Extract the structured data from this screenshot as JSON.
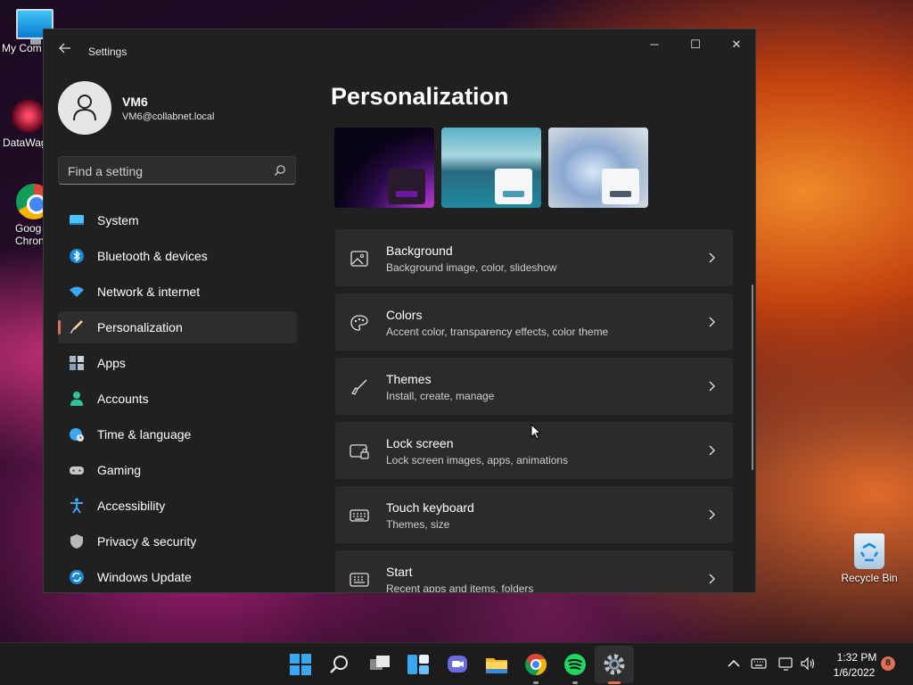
{
  "desktop": {
    "icons": [
      {
        "label": "My Com"
      },
      {
        "label": "DataWag"
      },
      {
        "label": "Goog Chron"
      },
      {
        "label": "Recycle Bin"
      }
    ]
  },
  "window": {
    "title": "Settings",
    "controls": {
      "minimize": "─",
      "maximize": "☐",
      "close": "✕"
    }
  },
  "profile": {
    "name": "VM6",
    "email": "VM6@collabnet.local"
  },
  "search": {
    "placeholder": "Find a setting"
  },
  "nav": {
    "items": [
      {
        "label": "System",
        "icon": "monitor-icon"
      },
      {
        "label": "Bluetooth & devices",
        "icon": "bluetooth-icon"
      },
      {
        "label": "Network & internet",
        "icon": "wifi-icon"
      },
      {
        "label": "Personalization",
        "icon": "brush-icon",
        "active": true
      },
      {
        "label": "Apps",
        "icon": "apps-icon"
      },
      {
        "label": "Accounts",
        "icon": "person-icon"
      },
      {
        "label": "Time & language",
        "icon": "globe-clock-icon"
      },
      {
        "label": "Gaming",
        "icon": "gamepad-icon"
      },
      {
        "label": "Accessibility",
        "icon": "accessibility-icon"
      },
      {
        "label": "Privacy & security",
        "icon": "shield-icon"
      },
      {
        "label": "Windows Update",
        "icon": "update-icon"
      }
    ]
  },
  "main": {
    "title": "Personalization",
    "cards": [
      {
        "title": "Background",
        "subtitle": "Background image, color, slideshow",
        "icon": "image-icon"
      },
      {
        "title": "Colors",
        "subtitle": "Accent color, transparency effects, color theme",
        "icon": "palette-icon"
      },
      {
        "title": "Themes",
        "subtitle": "Install, create, manage",
        "icon": "brush-icon"
      },
      {
        "title": "Lock screen",
        "subtitle": "Lock screen images, apps, animations",
        "icon": "lock-screen-icon"
      },
      {
        "title": "Touch keyboard",
        "subtitle": "Themes, size",
        "icon": "keyboard-icon"
      },
      {
        "title": "Start",
        "subtitle": "Recent apps and items, folders",
        "icon": "start-icon"
      }
    ]
  },
  "taskbar": {
    "time": "1:32 PM",
    "date": "1/6/2022",
    "notification_count": "8"
  },
  "colors": {
    "accent": "#e06f58",
    "window_bg": "#202020",
    "card_bg": "#2b2b2b"
  }
}
